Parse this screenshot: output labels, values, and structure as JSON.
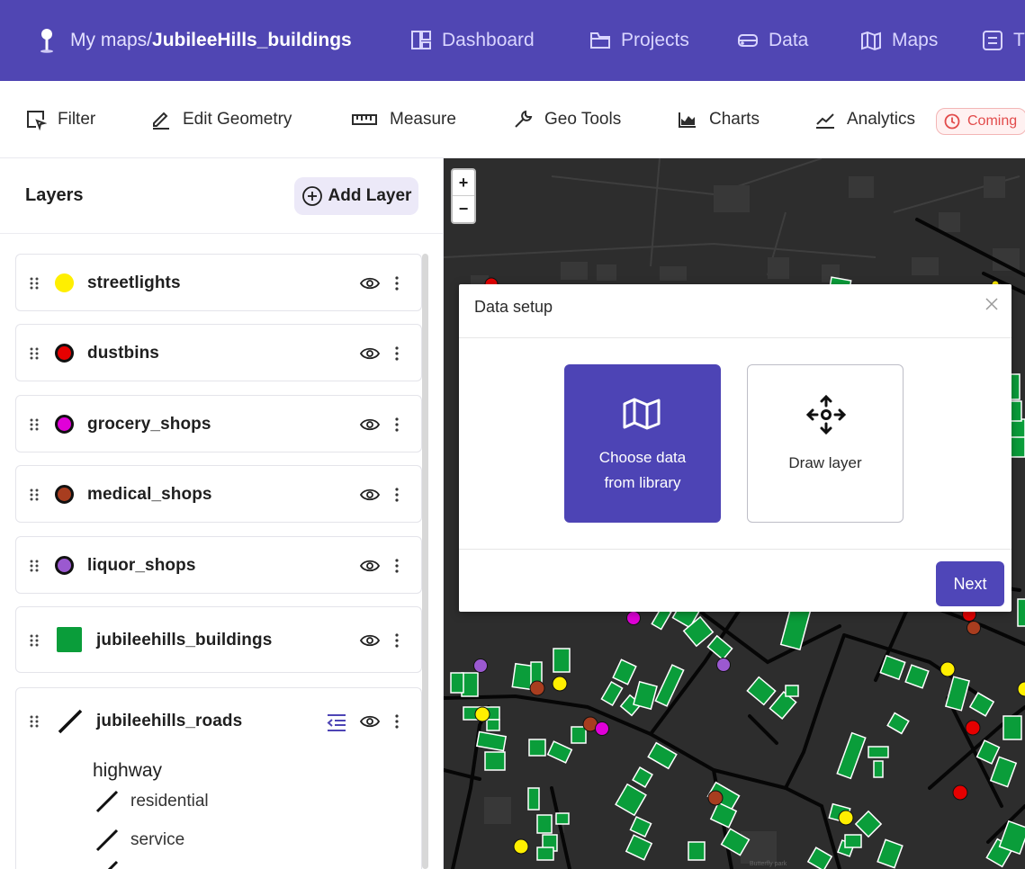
{
  "nav": {
    "crumb_prefix": "My maps/",
    "crumb_current": "JubileeHills_buildings",
    "links": [
      "Dashboard",
      "Projects",
      "Data",
      "Maps",
      "T"
    ]
  },
  "toolbar": {
    "filter": "Filter",
    "edit_geometry": "Edit Geometry",
    "measure": "Measure",
    "geo_tools": "Geo Tools",
    "charts": "Charts",
    "analytics": "Analytics",
    "coming_badge": "Coming"
  },
  "panel": {
    "title": "Layers",
    "add_layer": "Add Layer",
    "layers": [
      {
        "name": "streetlights",
        "color": "#ffef00"
      },
      {
        "name": "dustbins",
        "color": "#e60000"
      },
      {
        "name": "grocery_shops",
        "color": "#e000d8"
      },
      {
        "name": "medical_shops",
        "color": "#a83d1f"
      },
      {
        "name": "liquor_shops",
        "color": "#9b59d0"
      },
      {
        "name": "jubileehills_buildings",
        "color": "#0a9d3a"
      },
      {
        "name": "jubileehills_roads",
        "color": "#111111"
      }
    ],
    "legend": {
      "title": "highway",
      "items": [
        "residential",
        "service"
      ]
    }
  },
  "map": {
    "zoom_in": "+",
    "zoom_out": "−",
    "place_label": "Butterfly park"
  },
  "modal": {
    "title": "Data setup",
    "option_library_line1": "Choose data",
    "option_library_line2": "from library",
    "option_draw": "Draw layer",
    "next": "Next"
  },
  "colors": {
    "brand": "#5046b3",
    "buildings": "#0a9d3a",
    "map_background": "#2d2d2d"
  }
}
